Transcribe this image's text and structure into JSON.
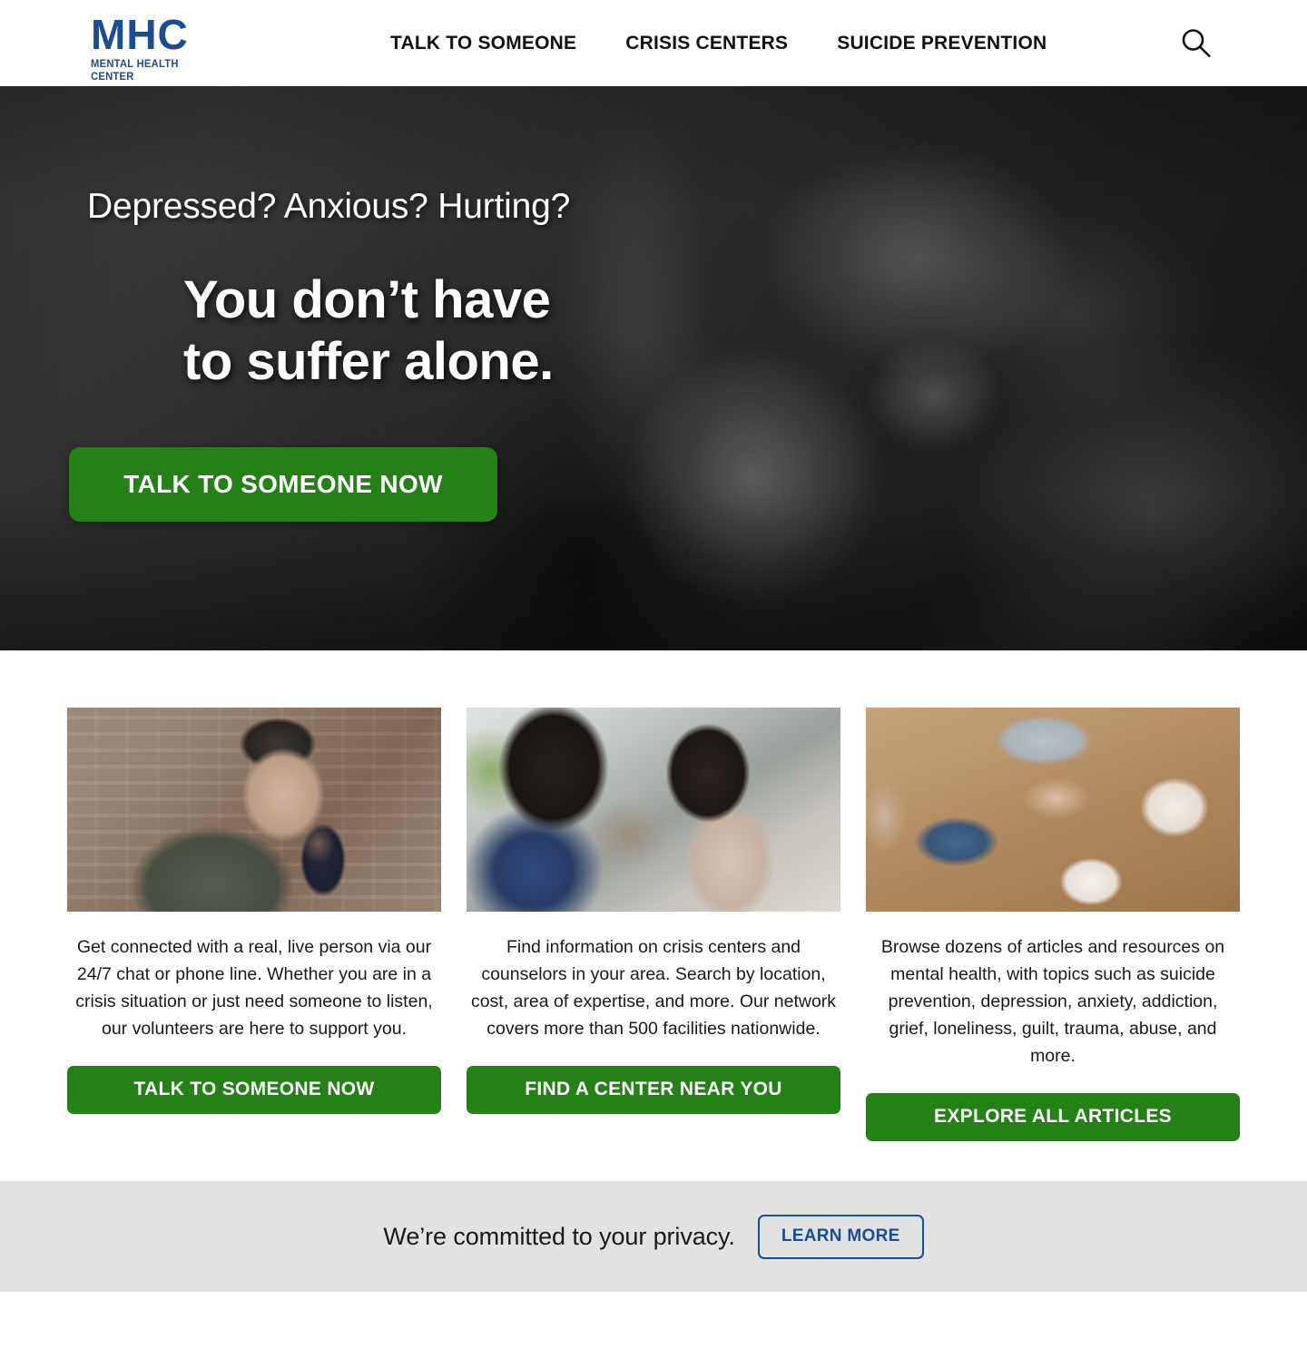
{
  "header": {
    "logo": {
      "mark": "MHC",
      "subtitle": "MENTAL HEALTH CENTER",
      "color": "#1C4C91"
    },
    "nav": [
      {
        "label": "TALK TO SOMEONE"
      },
      {
        "label": "CRISIS CENTERS"
      },
      {
        "label": "SUICIDE PREVENTION"
      }
    ],
    "search_icon": "search-icon"
  },
  "hero": {
    "eyebrow": "Depressed? Anxious? Hurting?",
    "title_line1": "You don’t have",
    "title_line2": "to suffer alone.",
    "cta_label": "TALK TO SOMEONE NOW",
    "cta_color": "#238116",
    "image_description": "Black and white photo of a woman resting her head on another person’s shoulder being comforted"
  },
  "cards": [
    {
      "image_description": "Man in green sweater speaking into a smartphone in front of a brick wall",
      "text": "Get connected with a real, live person via our 24/7 chat or phone line. Whether you are in a crisis situation or just need someone to listen, our volunteers are here to support you.",
      "button_label": "TALK TO SOMEONE NOW"
    },
    {
      "image_description": "Two women seated on a couch in conversation in a bright room with plants",
      "text": "Find information on crisis centers and counselors in your area. Search by location, cost, area of expertise, and more. Our network covers more than 500 facilities nationwide.",
      "button_label": "FIND A CENTER NEAR YOU"
    },
    {
      "image_description": "Two people holding hands across a wooden table with cups of coffee",
      "text": "Browse dozens of articles and resources on mental health, with topics such as suicide prevention, depression, anxiety, addiction, grief, loneliness, guilt, trauma, abuse, and more.",
      "button_label": "EXPLORE ALL ARTICLES"
    }
  ],
  "privacy": {
    "message": "We’re committed to your privacy.",
    "button_label": "LEARN MORE",
    "accent_color": "#1C4C91",
    "background": "#E2E2E2"
  }
}
